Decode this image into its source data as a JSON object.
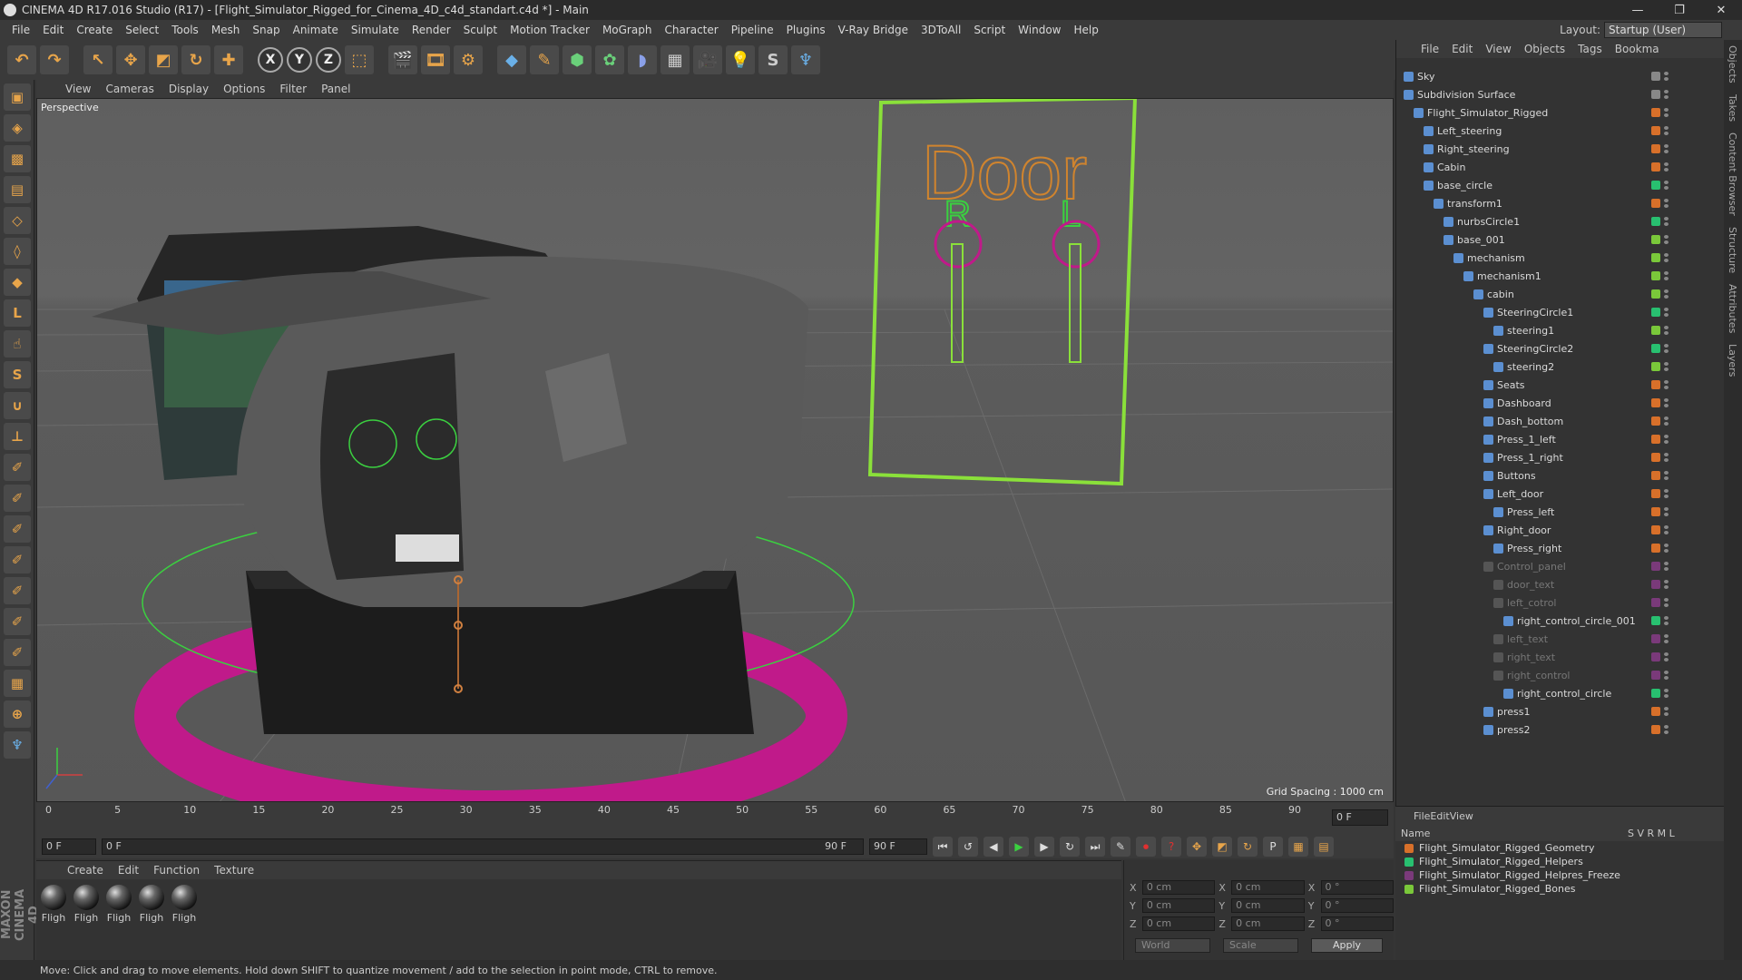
{
  "window": {
    "title": "CINEMA 4D R17.016 Studio (R17) - [Flight_Simulator_Rigged_for_Cinema_4D_c4d_standart.c4d *] - Main",
    "controls": [
      "—",
      "❐",
      "✕"
    ]
  },
  "menu": [
    "File",
    "Edit",
    "Create",
    "Select",
    "Tools",
    "Mesh",
    "Snap",
    "Animate",
    "Simulate",
    "Render",
    "Sculpt",
    "Motion Tracker",
    "MoGraph",
    "Character",
    "Pipeline",
    "Plugins",
    "V-Ray Bridge",
    "3DToAll",
    "Script",
    "Window",
    "Help"
  ],
  "layout": {
    "label": "Layout:",
    "value": "Startup (User)"
  },
  "viewport_menu": [
    "View",
    "Cameras",
    "Display",
    "Options",
    "Filter",
    "Panel"
  ],
  "viewport": {
    "label": "Perspective",
    "grid": "Grid Spacing : 1000 cm",
    "door_text": "Door",
    "r_text": "R",
    "l_text": "L"
  },
  "timeline": {
    "ticks": [
      "0",
      "5",
      "10",
      "15",
      "20",
      "25",
      "30",
      "35",
      "40",
      "45",
      "50",
      "55",
      "60",
      "65",
      "70",
      "75",
      "80",
      "85",
      "90"
    ],
    "frame_right": "0 F"
  },
  "playbar": {
    "start": "0 F",
    "current": "0 F",
    "end_inner": "90 F",
    "end": "90 F"
  },
  "material_menu": [
    "Create",
    "Edit",
    "Function",
    "Texture"
  ],
  "materials": [
    "Fligh",
    "Fligh",
    "Fligh",
    "Fligh",
    "Fligh"
  ],
  "coords": {
    "rows": [
      [
        "X",
        "0 cm",
        "X",
        "0 cm",
        "X",
        "0 °"
      ],
      [
        "Y",
        "0 cm",
        "Y",
        "0 cm",
        "Y",
        "0 °"
      ],
      [
        "Z",
        "0 cm",
        "Z",
        "0 cm",
        "Z",
        "0 °"
      ]
    ],
    "world": "World",
    "scale": "Scale",
    "apply": "Apply"
  },
  "object_menu": [
    "File",
    "Edit",
    "View",
    "Objects",
    "Tags",
    "Bookma"
  ],
  "objects": [
    {
      "name": "Sky",
      "indent": 0,
      "dim": false,
      "color": "#888"
    },
    {
      "name": "Subdivision Surface",
      "indent": 0,
      "dim": false,
      "color": "#888"
    },
    {
      "name": "Flight_Simulator_Rigged",
      "indent": 1,
      "dim": false,
      "color": "#d8702a"
    },
    {
      "name": "Left_steering",
      "indent": 2,
      "dim": false,
      "color": "#d8702a"
    },
    {
      "name": "Right_steering",
      "indent": 2,
      "dim": false,
      "color": "#d8702a"
    },
    {
      "name": "Cabin",
      "indent": 2,
      "dim": false,
      "color": "#d8702a"
    },
    {
      "name": "base_circle",
      "indent": 2,
      "dim": false,
      "color": "#28c070"
    },
    {
      "name": "transform1",
      "indent": 3,
      "dim": false,
      "color": "#d8702a"
    },
    {
      "name": "nurbsCircle1",
      "indent": 4,
      "dim": false,
      "color": "#28c070"
    },
    {
      "name": "base_001",
      "indent": 4,
      "dim": false,
      "color": "#7ac83a"
    },
    {
      "name": "mechanism",
      "indent": 5,
      "dim": false,
      "color": "#7ac83a"
    },
    {
      "name": "mechanism1",
      "indent": 6,
      "dim": false,
      "color": "#7ac83a"
    },
    {
      "name": "cabin",
      "indent": 7,
      "dim": false,
      "color": "#7ac83a"
    },
    {
      "name": "SteeringCircle1",
      "indent": 8,
      "dim": false,
      "color": "#28c070"
    },
    {
      "name": "steering1",
      "indent": 9,
      "dim": false,
      "color": "#7ac83a"
    },
    {
      "name": "SteeringCircle2",
      "indent": 8,
      "dim": false,
      "color": "#28c070"
    },
    {
      "name": "steering2",
      "indent": 9,
      "dim": false,
      "color": "#7ac83a"
    },
    {
      "name": "Seats",
      "indent": 8,
      "dim": false,
      "color": "#d8702a"
    },
    {
      "name": "Dashboard",
      "indent": 8,
      "dim": false,
      "color": "#d8702a"
    },
    {
      "name": "Dash_bottom",
      "indent": 8,
      "dim": false,
      "color": "#d8702a"
    },
    {
      "name": "Press_1_left",
      "indent": 8,
      "dim": false,
      "color": "#d8702a"
    },
    {
      "name": "Press_1_right",
      "indent": 8,
      "dim": false,
      "color": "#d8702a"
    },
    {
      "name": "Buttons",
      "indent": 8,
      "dim": false,
      "color": "#d8702a"
    },
    {
      "name": "Left_door",
      "indent": 8,
      "dim": false,
      "color": "#d8702a"
    },
    {
      "name": "Press_left",
      "indent": 9,
      "dim": false,
      "color": "#d8702a"
    },
    {
      "name": "Right_door",
      "indent": 8,
      "dim": false,
      "color": "#d8702a"
    },
    {
      "name": "Press_right",
      "indent": 9,
      "dim": false,
      "color": "#d8702a"
    },
    {
      "name": "Control_panel",
      "indent": 8,
      "dim": true,
      "color": "#7a3a7a"
    },
    {
      "name": "door_text",
      "indent": 9,
      "dim": true,
      "color": "#7a3a7a"
    },
    {
      "name": "left_cotrol",
      "indent": 9,
      "dim": true,
      "color": "#7a3a7a"
    },
    {
      "name": "right_control_circle_001",
      "indent": 10,
      "dim": false,
      "color": "#28c070"
    },
    {
      "name": "left_text",
      "indent": 9,
      "dim": true,
      "color": "#7a3a7a"
    },
    {
      "name": "right_text",
      "indent": 9,
      "dim": true,
      "color": "#7a3a7a"
    },
    {
      "name": "right_control",
      "indent": 9,
      "dim": true,
      "color": "#7a3a7a"
    },
    {
      "name": "right_control_circle",
      "indent": 10,
      "dim": false,
      "color": "#28c070"
    },
    {
      "name": "press1",
      "indent": 8,
      "dim": false,
      "color": "#d8702a"
    },
    {
      "name": "press2",
      "indent": 8,
      "dim": false,
      "color": "#d8702a"
    }
  ],
  "layer_menu": [
    "File",
    "Edit",
    "View"
  ],
  "layer_header": {
    "name": "Name",
    "cols": "S V R M L"
  },
  "layers": [
    {
      "name": "Flight_Simulator_Rigged_Geometry",
      "color": "#d8702a"
    },
    {
      "name": "Flight_Simulator_Rigged_Helpers",
      "color": "#28c070"
    },
    {
      "name": "Flight_Simulator_Rigged_Helpres_Freeze",
      "color": "#7a3a7a"
    },
    {
      "name": "Flight_Simulator_Rigged_Bones",
      "color": "#7ac83a"
    }
  ],
  "right_tabs": [
    "Objects",
    "Takes",
    "Content Browser",
    "Structure",
    "Attributes",
    "Layers"
  ],
  "status": "Move: Click and drag to move elements. Hold down SHIFT to quantize movement / add to the selection in point mode, CTRL to remove.",
  "maxon": "MAXON CINEMA 4D"
}
